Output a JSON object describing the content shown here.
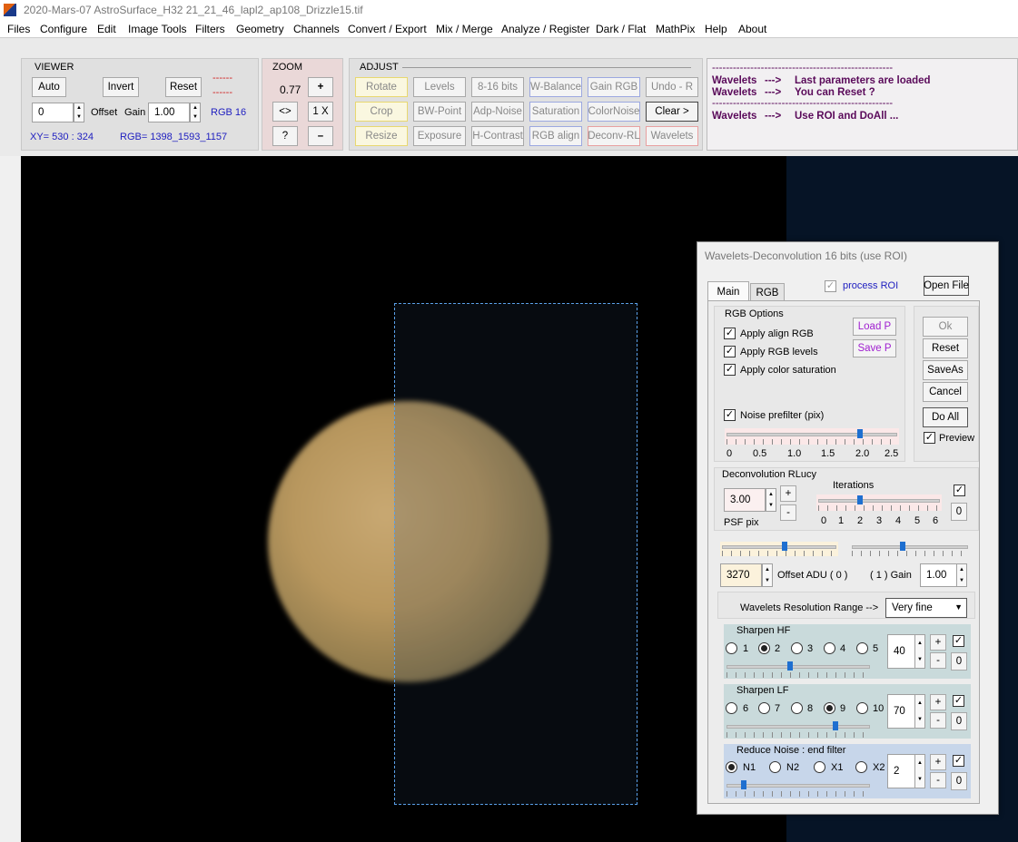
{
  "window": {
    "title": "2020-Mars-07  AstroSurface_H32    21_21_46_lapl2_ap108_Drizzle15.tif"
  },
  "menu": [
    "Files",
    "Configure",
    "Edit",
    "Image Tools",
    "Filters",
    "Geometry",
    "Channels",
    "Convert / Export",
    "Mix / Merge",
    "Analyze / Register",
    "Dark / Flat",
    "MathPix",
    "Help",
    "About"
  ],
  "viewer": {
    "label": "VIEWER",
    "auto": "Auto",
    "invert": "Invert",
    "reset": "Reset",
    "dashes1": "------",
    "dashes2": "------",
    "offset_value": "0",
    "offset_label": "Offset",
    "gain_label": "Gain",
    "gain_value": "1.00",
    "rgb_bits": "RGB 16",
    "xy": "XY=  530 : 324",
    "rgb": "RGB=  1398_1593_1157"
  },
  "zoom": {
    "label": "ZOOM",
    "value": "0.77",
    "plus": "+",
    "fit": "<>",
    "one": "1 X",
    "help": "?",
    "minus": "–"
  },
  "adjust": {
    "label": "ADJUST",
    "rows": [
      [
        "Rotate",
        "Levels",
        "8-16 bits",
        "W-Balance",
        "Gain RGB",
        "Undo - R"
      ],
      [
        "Crop",
        "BW-Point",
        "Adp-Noise",
        "Saturation",
        "ColorNoise",
        "Clear >"
      ],
      [
        "Resize",
        "Exposure",
        "H-Contrast",
        "RGB align",
        "Deconv-RL",
        "Wavelets"
      ]
    ]
  },
  "log": {
    "sep1": "----------------------------------------------------",
    "l1a": "Wavelets",
    "l1b": "--->",
    "l1c": "Last parameters are loaded",
    "l2a": "Wavelets",
    "l2b": "--->",
    "l2c": "You can Reset ?",
    "sep2": "----------------------------------------------------",
    "l3a": "Wavelets",
    "l3b": "--->",
    "l3c": "Use ROI and DoAll ..."
  },
  "dialog": {
    "title": "Wavelets-Deconvolution 16 bits (use ROI)",
    "tab_main": "Main",
    "tab_rgb": "RGB",
    "process_roi": "process ROI",
    "process_roi_checked": true,
    "open_file": "Open File",
    "rgb_options": "RGB Options",
    "apply_align": "Apply align RGB",
    "apply_levels": "Apply RGB levels",
    "apply_sat": "Apply color saturation",
    "load_p": "Load P",
    "save_p": "Save P",
    "ok": "Ok",
    "reset": "Reset",
    "saveas": "SaveAs",
    "cancel": "Cancel",
    "doall": "Do All",
    "preview": "Preview",
    "noise_prefilter": "Noise prefilter (pix)",
    "noise_prefilter_value": 2.0,
    "noise_ticks": [
      "0",
      "0.5",
      "1.0",
      "1.5",
      "2.0",
      "2.5"
    ],
    "deconv_label": "Deconvolution RLucy",
    "iterations_label": "Iterations",
    "psf_value": "3.00",
    "psf_label": "PSF pix",
    "plus": "+",
    "minus": "-",
    "iter_ticks": [
      "0",
      "1",
      "2",
      "3",
      "4",
      "5",
      "6"
    ],
    "iter_value": 2,
    "zero": "0",
    "offset_adu_value": "3270",
    "offset_adu_label": "Offset ADU ( 0 )",
    "gain_label": "( 1 )  Gain",
    "gain_value": "1.00",
    "range_label": "Wavelets Resolution Range  -->",
    "range_value": "Very fine",
    "hf_label": "Sharpen HF",
    "hf_options": [
      "1",
      "2",
      "3",
      "4",
      "5"
    ],
    "hf_selected": "2",
    "hf_value": "40",
    "lf_label": "Sharpen LF",
    "lf_options": [
      "6",
      "7",
      "8",
      "9",
      "10"
    ],
    "lf_selected": "9",
    "lf_value": "70",
    "nr_label": "Reduce Noise : end filter",
    "nr_options": [
      "N1",
      "N2",
      "X1",
      "X2"
    ],
    "nr_selected": "N1",
    "nr_value": "2"
  },
  "colors": {
    "accent_blue": "#2020c0",
    "log_text": "#5a0a5a",
    "roi_border": "#5aa0e8"
  }
}
